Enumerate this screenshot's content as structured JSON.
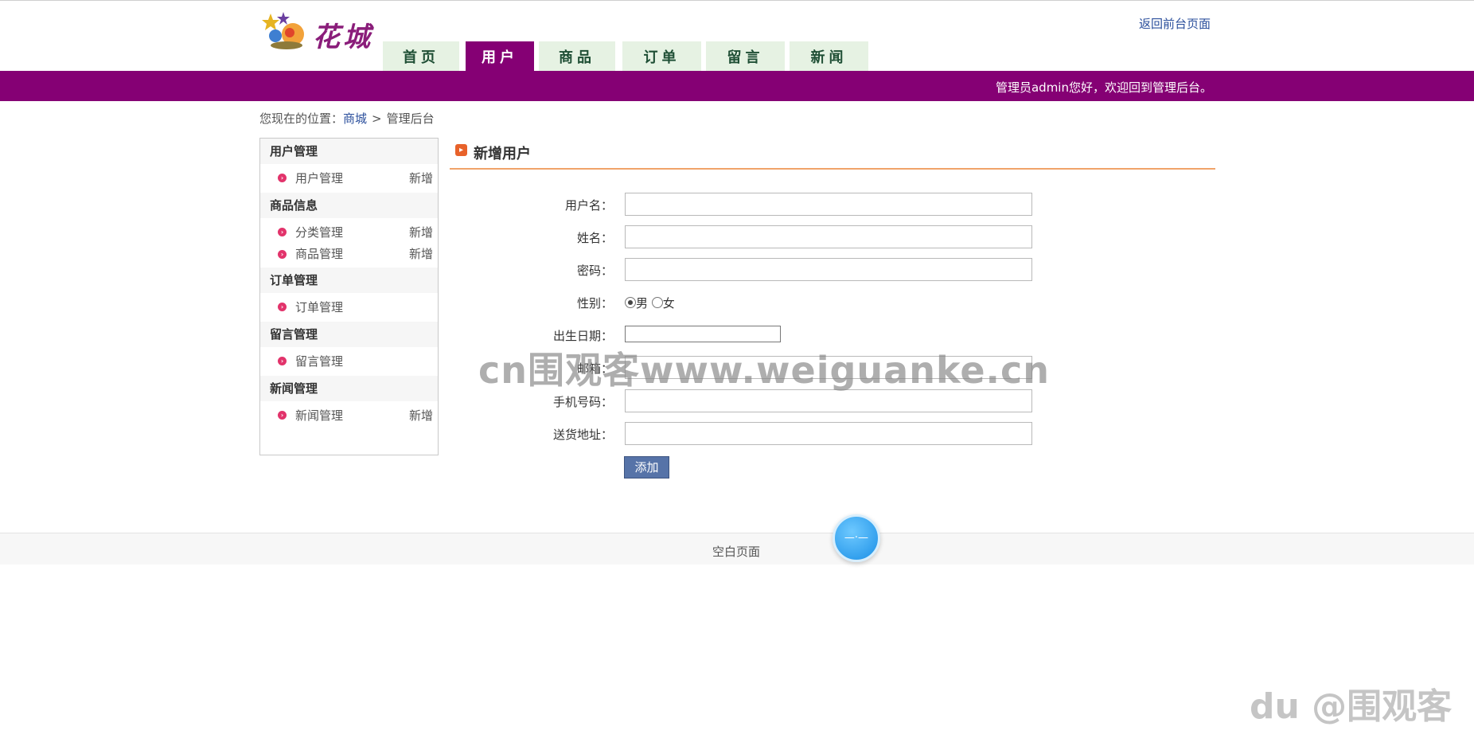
{
  "header": {
    "logo_text": "花城",
    "top_link": "返回前台页面",
    "welcome": "管理员admin您好，欢迎回到管理后台。",
    "nav": [
      {
        "label": "首页",
        "active": false
      },
      {
        "label": "用户",
        "active": true
      },
      {
        "label": "商品",
        "active": false
      },
      {
        "label": "订单",
        "active": false
      },
      {
        "label": "留言",
        "active": false
      },
      {
        "label": "新闻",
        "active": false
      }
    ]
  },
  "breadcrumb": {
    "prefix": "您现在的位置：",
    "home": "商城",
    "separator": ">",
    "current": "管理后台"
  },
  "sidebar": {
    "sections": [
      {
        "title": "用户管理",
        "items": [
          {
            "label": "用户管理",
            "action": "新增"
          }
        ]
      },
      {
        "title": "商品信息",
        "items": [
          {
            "label": "分类管理",
            "action": "新增"
          },
          {
            "label": "商品管理",
            "action": "新增"
          }
        ]
      },
      {
        "title": "订单管理",
        "items": [
          {
            "label": "订单管理",
            "action": ""
          }
        ]
      },
      {
        "title": "留言管理",
        "items": [
          {
            "label": "留言管理",
            "action": ""
          }
        ]
      },
      {
        "title": "新闻管理",
        "items": [
          {
            "label": "新闻管理",
            "action": "新增"
          }
        ]
      }
    ]
  },
  "main": {
    "title": "新增用户",
    "form": {
      "username_label": "用户名：",
      "name_label": "姓名：",
      "password_label": "密码：",
      "gender_label": "性别：",
      "gender_male": "男",
      "gender_female": "女",
      "birthday_label": "出生日期：",
      "email_label": "邮箱：",
      "phone_label": "手机号码：",
      "address_label": "送货地址：",
      "submit_label": "添加"
    }
  },
  "watermark": "cn围观客www.weiguanke.cn",
  "footer": {
    "text": "空白页面",
    "float_ball": "—·—",
    "corner_mark": "du @围观客"
  },
  "colors": {
    "brand_purple": "#850074",
    "tab_bg": "#e6f2e3",
    "title_underline": "#f0a36a",
    "button_blue": "#5673a8"
  }
}
